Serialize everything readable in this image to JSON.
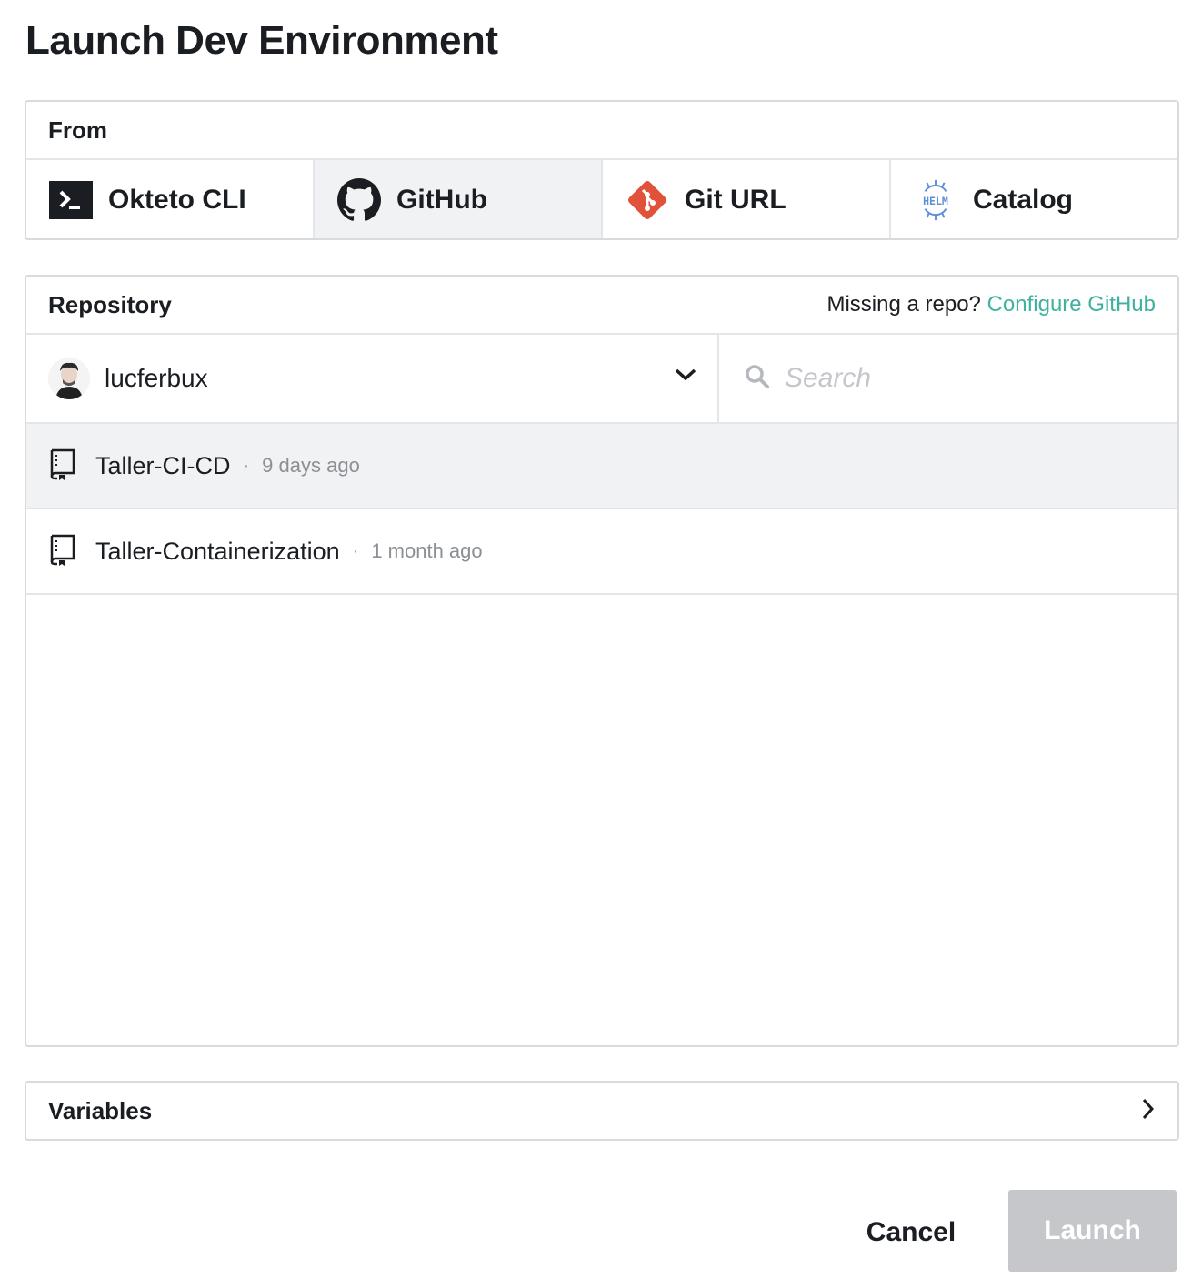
{
  "title": "Launch Dev Environment",
  "from": {
    "label": "From",
    "tabs": [
      {
        "label": "Okteto CLI",
        "icon": "terminal-icon",
        "active": false
      },
      {
        "label": "GitHub",
        "icon": "github-icon",
        "active": true
      },
      {
        "label": "Git URL",
        "icon": "git-icon",
        "active": false
      },
      {
        "label": "Catalog",
        "icon": "helm-icon",
        "active": false
      }
    ]
  },
  "repository": {
    "label": "Repository",
    "missing_text": "Missing a repo?",
    "configure_link": "Configure GitHub",
    "owner": "lucferbux",
    "search_placeholder": "Search",
    "items": [
      {
        "name": "Taller-CI-CD",
        "separator": "·",
        "time": "9 days ago",
        "selected": true
      },
      {
        "name": "Taller-Containerization",
        "separator": "·",
        "time": "1 month ago",
        "selected": false
      }
    ]
  },
  "variables": {
    "label": "Variables"
  },
  "actions": {
    "cancel": "Cancel",
    "launch": "Launch"
  },
  "colors": {
    "link": "#3fb19f",
    "git": "#e0533a",
    "helm": "#5b8fd6",
    "launch_disabled": "#c5c7ca"
  }
}
